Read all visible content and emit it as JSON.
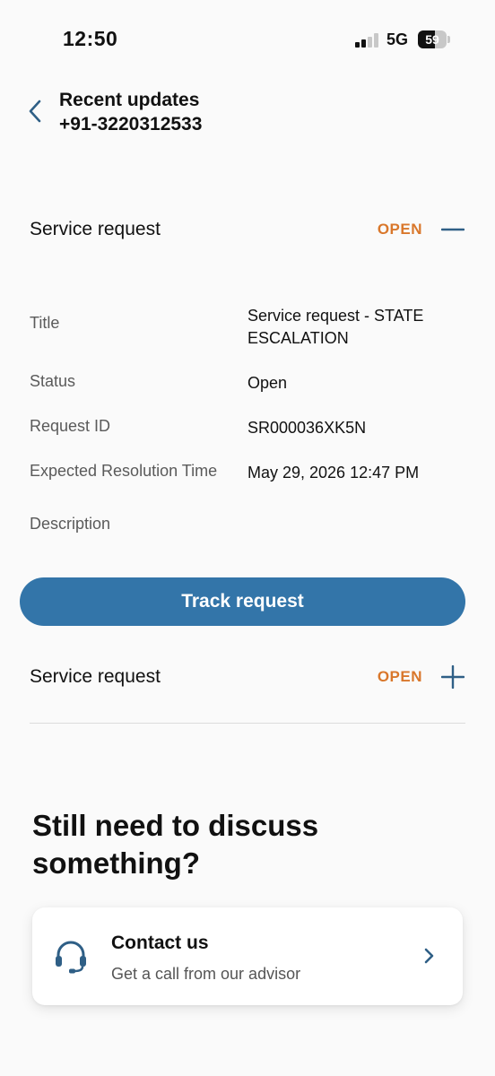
{
  "status_bar": {
    "time": "12:50",
    "network": "5G",
    "battery": "59",
    "battery_level": 0.59
  },
  "header": {
    "title": "Recent updates",
    "subtitle": "+91-3220312533",
    "back_icon": "chevron-left-icon"
  },
  "requests": [
    {
      "label": "Service request",
      "status": "OPEN",
      "expanded": true,
      "details": [
        {
          "key": "Title",
          "value": "Service request - STATE ESCALATION"
        },
        {
          "key": "Status",
          "value": "Open"
        },
        {
          "key": "Request ID",
          "value": "SR000036XK5N"
        },
        {
          "key": "Expected Resolution Time",
          "value": "May 29, 2026 12:47 PM"
        },
        {
          "key": "Description",
          "value": ""
        }
      ],
      "action_label": "Track request"
    },
    {
      "label": "Service request",
      "status": "OPEN",
      "expanded": false
    }
  ],
  "discuss": {
    "title": "Still need to discuss something?"
  },
  "contact": {
    "title": "Contact us",
    "subtitle": "Get a call from our advisor",
    "icon": "headset-icon"
  },
  "colors": {
    "accent": "#3375a9",
    "status_open": "#d9772b",
    "icon": "#2f5f86"
  }
}
